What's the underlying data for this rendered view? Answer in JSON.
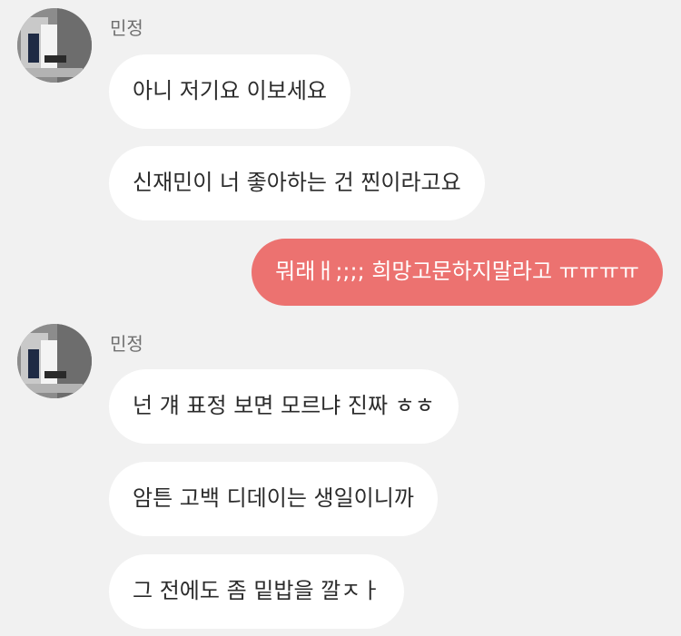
{
  "chat": {
    "group1": {
      "sender": "민정",
      "avatar_icon": "profile-photo",
      "messages": [
        "아니 저기요 이보세요",
        "신재민이 너 좋아하는 건 찐이라고요"
      ]
    },
    "outgoing": {
      "message": "뭐래ㅐ;;;; 희망고문하지말라고 ㅠㅠㅠㅠ"
    },
    "group2": {
      "sender": "민정",
      "avatar_icon": "profile-photo",
      "messages": [
        "넌 걔 표정 보면 모르냐 진짜 ㅎㅎ",
        "암튼 고백 디데이는 생일이니까",
        "그 전에도 좀 밑밥을 깔ㅈㅏ"
      ]
    }
  },
  "colors": {
    "background": "#f1f1f1",
    "incoming_bubble": "#ffffff",
    "outgoing_bubble": "#ec7270",
    "name_text": "#6f6f6f"
  }
}
